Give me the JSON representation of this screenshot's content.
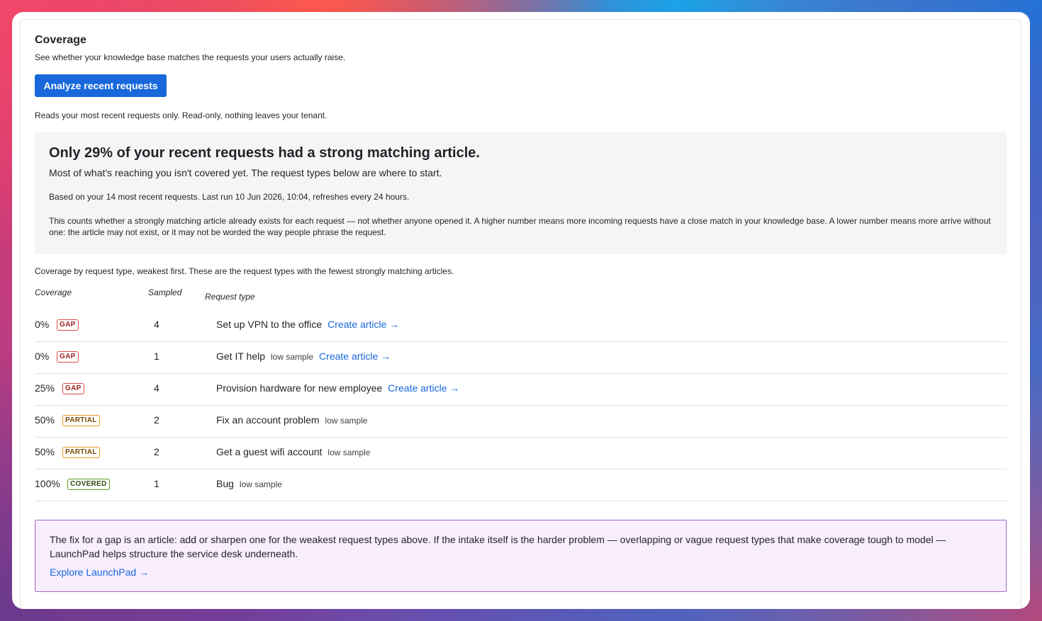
{
  "header": {
    "title": "Coverage",
    "subtitle": "See whether your knowledge base matches the requests your users actually raise.",
    "analyze_button": "Analyze recent requests",
    "readonly_note": "Reads your most recent requests only. Read-only, nothing leaves your tenant."
  },
  "summary": {
    "headline": "Only 29% of your recent requests had a strong matching article.",
    "description": "Most of what's reaching you isn't covered yet. The request types below are where to start.",
    "based_on": "Based on your 14 most recent requests. Last run 10 Jun 2026, 10:04, refreshes every 24 hours.",
    "explanation": "This counts whether a strongly matching article already exists for each request — not whether anyone opened it. A higher number means more incoming requests have a close match in your knowledge base. A lower number means more arrive without one: the article may not exist, or it may not be worded the way people phrase the request."
  },
  "table": {
    "intro": "Coverage by request type, weakest first. These are the request types with the fewest strongly matching articles.",
    "columns": {
      "coverage": "Coverage",
      "sampled": "Sampled",
      "request_type": "Request type"
    },
    "rows": [
      {
        "coverage": "0%",
        "status": "GAP",
        "sampled": "4",
        "request_type": "Set up VPN to the office",
        "low_sample": "",
        "link": "Create article →"
      },
      {
        "coverage": "0%",
        "status": "GAP",
        "sampled": "1",
        "request_type": "Get IT help",
        "low_sample": "low sample",
        "link": "Create article →"
      },
      {
        "coverage": "25%",
        "status": "GAP",
        "sampled": "4",
        "request_type": "Provision hardware for new employee",
        "low_sample": "",
        "link": "Create article →"
      },
      {
        "coverage": "50%",
        "status": "PARTIAL",
        "sampled": "2",
        "request_type": "Fix an account problem",
        "low_sample": "low sample",
        "link": ""
      },
      {
        "coverage": "50%",
        "status": "PARTIAL",
        "sampled": "2",
        "request_type": "Get a guest wifi account",
        "low_sample": "low sample",
        "link": ""
      },
      {
        "coverage": "100%",
        "status": "COVERED",
        "sampled": "1",
        "request_type": "Bug",
        "low_sample": "low sample",
        "link": ""
      }
    ]
  },
  "callout": {
    "text": "The fix for a gap is an article: add or sharpen one for the weakest request types above. If the intake itself is the harder problem — overlapping or vague request types that make coverage tough to model — LaunchPad helps structure the service desk underneath.",
    "link": "Explore LaunchPad →"
  },
  "colors": {
    "accent": "#1868db",
    "gap": "#e04a4a",
    "partial": "#e39a1a",
    "covered": "#5a9a1a",
    "callout_bg": "#f8eefe",
    "callout_border": "#a866c9"
  }
}
